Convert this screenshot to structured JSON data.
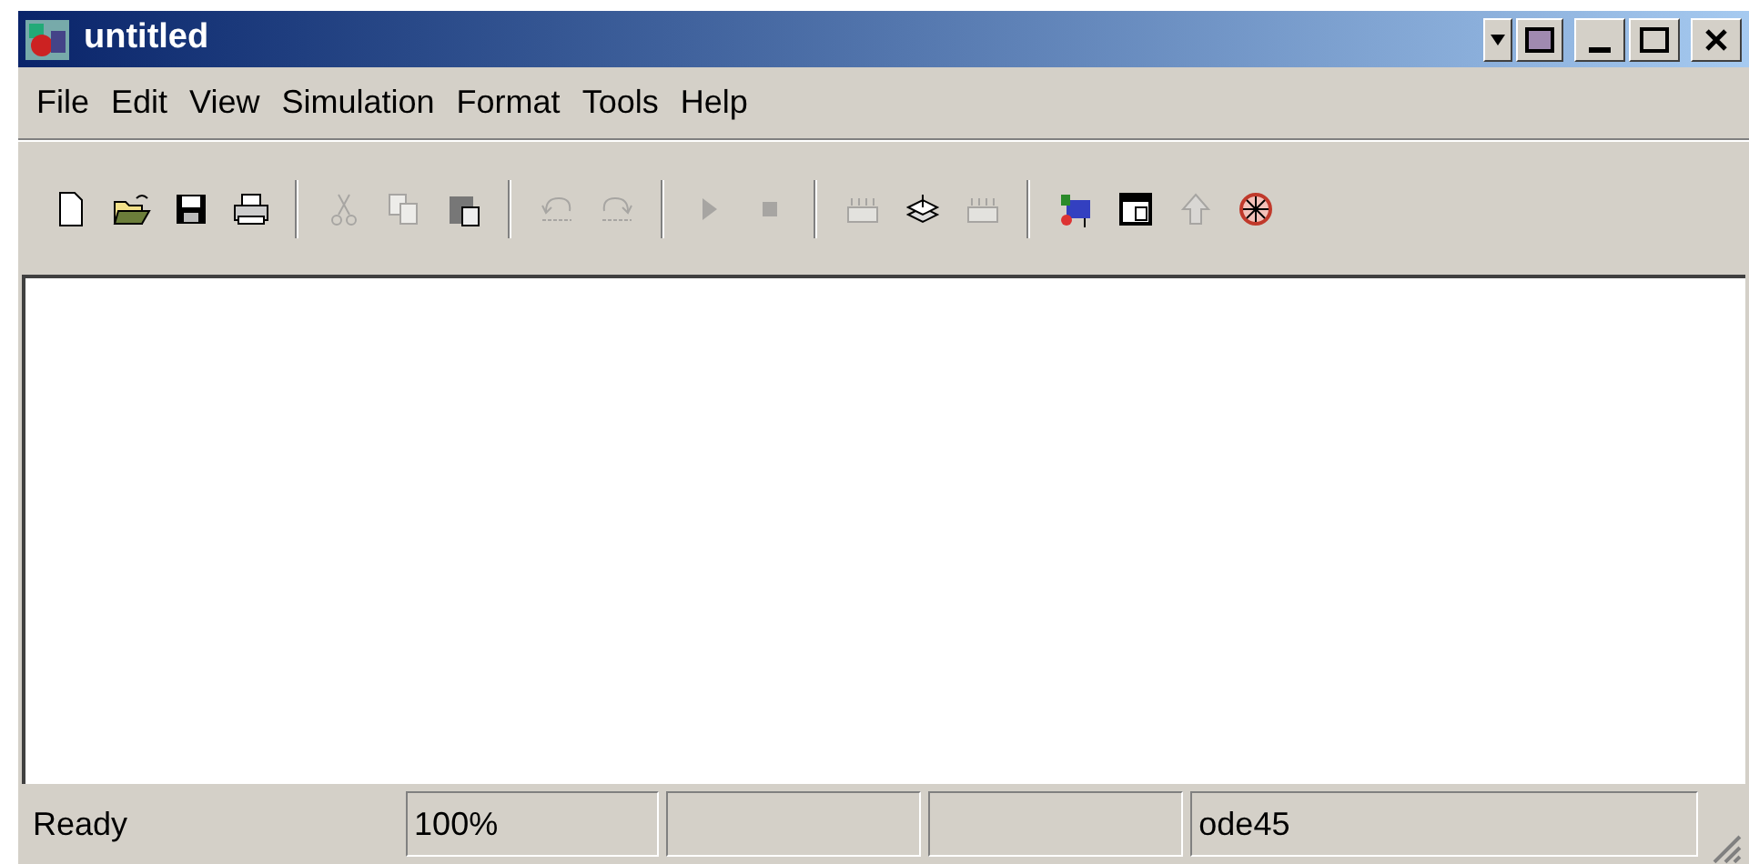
{
  "window": {
    "title": "untitled"
  },
  "menu": [
    "File",
    "Edit",
    "View",
    "Simulation",
    "Format",
    "Tools",
    "Help"
  ],
  "toolbar": [
    [
      {
        "kind": "new",
        "disabled": false
      },
      {
        "kind": "open",
        "disabled": false
      },
      {
        "kind": "save",
        "disabled": false
      },
      {
        "kind": "print",
        "disabled": false
      }
    ],
    [
      {
        "kind": "cut",
        "disabled": true
      },
      {
        "kind": "copy",
        "disabled": true
      },
      {
        "kind": "paste",
        "disabled": false
      }
    ],
    [
      {
        "kind": "undo",
        "disabled": true
      },
      {
        "kind": "redo",
        "disabled": true
      }
    ],
    [
      {
        "kind": "start",
        "disabled": true
      },
      {
        "kind": "stop",
        "disabled": true
      }
    ],
    [
      {
        "kind": "build",
        "disabled": true
      },
      {
        "kind": "update",
        "disabled": false
      },
      {
        "kind": "build",
        "disabled": true
      }
    ],
    [
      {
        "kind": "library",
        "disabled": false
      },
      {
        "kind": "browser",
        "disabled": false
      },
      {
        "kind": "up",
        "disabled": true
      },
      {
        "kind": "debug",
        "disabled": false
      }
    ]
  ],
  "status_bar": {
    "message": "Ready",
    "panes": [
      {
        "kind": "text",
        "text": "100%"
      },
      {
        "kind": "empty"
      },
      {
        "kind": "empty"
      },
      {
        "kind": "text",
        "text": "ode45"
      }
    ]
  }
}
